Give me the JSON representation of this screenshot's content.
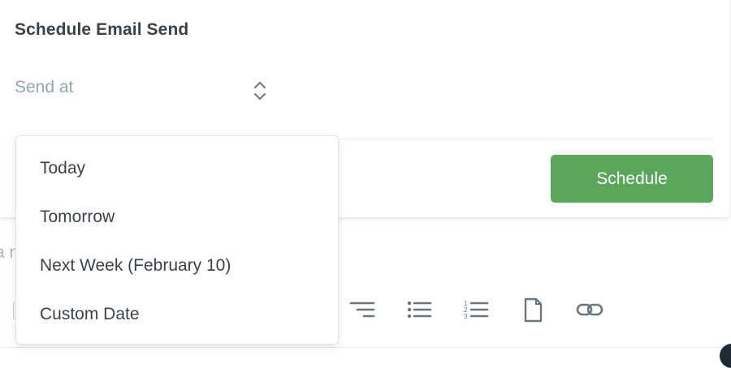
{
  "modal": {
    "title": "Schedule Email Send",
    "send_at_label": "Send at",
    "schedule_button": "Schedule"
  },
  "dropdown": {
    "options": [
      {
        "label": "Today"
      },
      {
        "label": "Tomorrow"
      },
      {
        "label": "Next Week (February 10)"
      },
      {
        "label": "Custom Date"
      }
    ]
  },
  "background": {
    "fragment_text": "a n"
  },
  "colors": {
    "accent_green": "#5aa65a",
    "placeholder_gray": "#9aa3ad",
    "text_dark": "#3d4247"
  },
  "icons": [
    "align-right-icon",
    "bullet-list-icon",
    "numbered-list-icon",
    "document-icon",
    "link-icon",
    "select-arrows-icon"
  ]
}
